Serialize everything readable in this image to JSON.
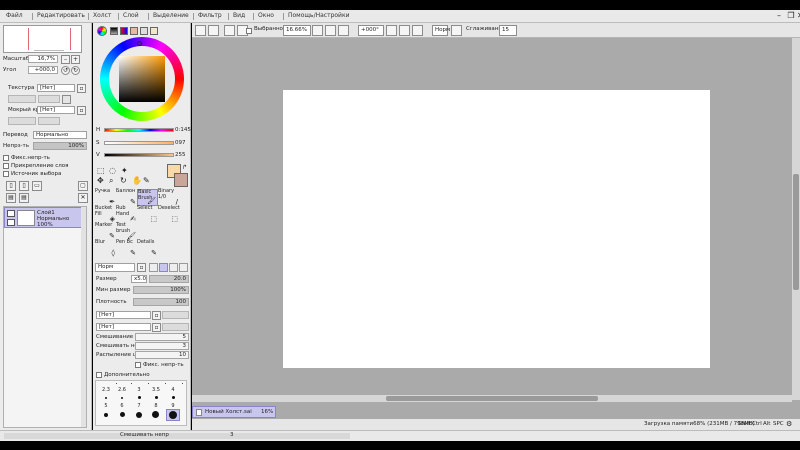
{
  "menubar": {
    "items": [
      "Файл",
      "Редактировать",
      "Холст",
      "Слой",
      "Выделение",
      "Фильтр",
      "Вид",
      "Окно",
      "Помощь/Настройки"
    ],
    "window_controls": [
      "–",
      "❐",
      "✕"
    ]
  },
  "navigator": {
    "zoom_label": "Масштаб",
    "zoom_value": "16,7%",
    "angle_label": "Угол",
    "angle_value": "+000,0"
  },
  "layer_props": {
    "texture_label": "Текстура",
    "texture_value": "[Нет]",
    "wet_edge_label": "Мокрый край",
    "wet_edge_value": "[Нет]",
    "blend_label": "Перевод",
    "blend_value": "Нормально",
    "opacity_label": "Непрз-ть",
    "opacity_value": "100%",
    "fix_opacity": "Фикс.непр-ть",
    "clip_layer": "Прикрепление слоя",
    "selection_source": "Источник выбора"
  },
  "layer": {
    "name": "Слой1",
    "mode": "Нормально",
    "opacity": "100%"
  },
  "colors": {
    "h_label": "H",
    "h_value": "0:145",
    "s_label": "S",
    "s_value": "097",
    "v_label": "V",
    "v_value": "255",
    "fg_color": "#f9d9a8",
    "bg_color": "#c9a59a",
    "accent": "#c9c6ee"
  },
  "tools": [
    {
      "label": "Ручка",
      "icon": "pen-icon",
      "glyph": "✒"
    },
    {
      "label": "Баллон",
      "icon": "airbrush-icon",
      "glyph": "✎"
    },
    {
      "label": "Basic Brush",
      "icon": "brush-icon",
      "glyph": "🖌"
    },
    {
      "label": "Binary 1/0",
      "icon": "binary-pen-icon",
      "glyph": "/"
    },
    {
      "label": "Bucket Fill",
      "icon": "bucket-icon",
      "glyph": "◈"
    },
    {
      "label": "Rub Hand",
      "icon": "rub-icon",
      "glyph": "✍"
    },
    {
      "label": "Select",
      "icon": "select-icon",
      "glyph": "⬚"
    },
    {
      "label": "Deselect",
      "icon": "deselect-icon",
      "glyph": "⬚"
    },
    {
      "label": "Marker",
      "icon": "marker-icon",
      "glyph": "✎"
    },
    {
      "label": "Test brush",
      "icon": "test-brush-icon",
      "glyph": "🖌"
    },
    {
      "label": "",
      "icon": "",
      "glyph": ""
    },
    {
      "label": "",
      "icon": "",
      "glyph": ""
    },
    {
      "label": "Blur",
      "icon": "blur-icon",
      "glyph": "◊"
    },
    {
      "label": "Pen Bc",
      "icon": "pen-bc-icon",
      "glyph": "✎"
    },
    {
      "label": "Details",
      "icon": "details-icon",
      "glyph": "✎"
    }
  ],
  "brush": {
    "mode": "Норм",
    "size_label": "Размер",
    "size_mult": "x5.0",
    "size_value": "20.0",
    "min_size_label": "Мин размер",
    "min_size_value": "100%",
    "density_label": "Плотность",
    "density_value": "100",
    "shape_value": "[Нет]",
    "texture_value": "[Нет]",
    "mix_color_label": "Смешивание цвет",
    "mix_color_value": "5",
    "mix_opacity_label": "Смешивать непр",
    "mix_opacity_value": "3",
    "spread_label": "Распыление цвет",
    "spread_value": "10",
    "fix_opacity_label": "Фикс. непр-ть",
    "advanced_label": "Дополнительно",
    "sizes_row1": [
      "2.3",
      "2.6",
      "3",
      "3.5",
      "4"
    ],
    "sizes_row2": [
      "5",
      "6",
      "7",
      "8",
      "9"
    ]
  },
  "canvas_toolbar": {
    "selection_label": "Выбранное",
    "zoom_value": "16.66%",
    "angle_value": "+000°",
    "mode_value": "Норм",
    "stabilizer_label": "Сглаживание",
    "stabilizer_value": "15"
  },
  "document": {
    "tab_name": "Новый Холст.sai",
    "tab_zoom": "16%"
  },
  "status": {
    "memory": "Загрузка памяти68% (231MB / 798MB)",
    "keys": [
      "Shift",
      "Ctrl",
      "Alt",
      "SPC"
    ]
  },
  "taskbar": {
    "text": "Смешивать непр",
    "value": "3"
  }
}
